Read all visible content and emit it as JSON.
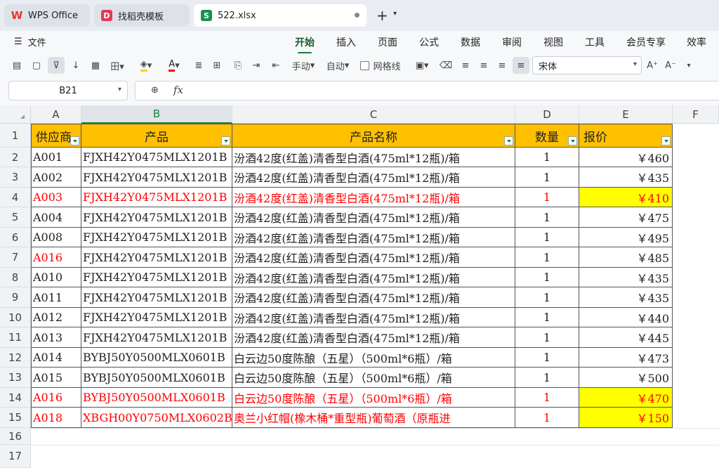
{
  "tabs": [
    {
      "label": "WPS Office",
      "icon": "wps-logo-icon",
      "color": "#e8342c"
    },
    {
      "label": "找稻壳模板",
      "icon": "docer-icon",
      "color": "#e23a53"
    },
    {
      "label": "522.xlsx",
      "icon": "sheet-icon",
      "color": "#1a8f4e"
    }
  ],
  "menu": {
    "file": "文件",
    "tabs": [
      "开始",
      "插入",
      "页面",
      "公式",
      "数据",
      "审阅",
      "视图",
      "工具",
      "会员专享",
      "效率"
    ],
    "active": "开始"
  },
  "toolbar": {
    "wrap_label": "手动",
    "autofit_label": "自动",
    "gridlines_label": "网格线",
    "font_name": "宋体"
  },
  "formula_bar": {
    "cell_ref": "B21",
    "fx": "fx",
    "value": ""
  },
  "columns": [
    "A",
    "B",
    "C",
    "D",
    "E",
    "F"
  ],
  "row_numbers": [
    "1",
    "2",
    "3",
    "4",
    "5",
    "6",
    "7",
    "8",
    "9",
    "10",
    "11",
    "12",
    "13",
    "14",
    "15",
    "16",
    "17"
  ],
  "headers": [
    "供应商",
    "产品",
    "产品名称",
    "数量",
    "报价"
  ],
  "rows": [
    {
      "supplier": "A001",
      "code": "FJXH42Y0475MLX1201B",
      "name": "汾酒42度(红盖)清香型白酒(475ml*12瓶)/箱",
      "qty": "1",
      "price": "￥460",
      "red": false,
      "yellow": false
    },
    {
      "supplier": "A002",
      "code": "FJXH42Y0475MLX1201B",
      "name": "汾酒42度(红盖)清香型白酒(475ml*12瓶)/箱",
      "qty": "1",
      "price": "￥435",
      "red": false,
      "yellow": false
    },
    {
      "supplier": "A003",
      "code": "FJXH42Y0475MLX1201B",
      "name": "汾酒42度(红盖)清香型白酒(475ml*12瓶)/箱",
      "qty": "1",
      "price": "￥410",
      "red": true,
      "yellow": true
    },
    {
      "supplier": "A004",
      "code": "FJXH42Y0475MLX1201B",
      "name": "汾酒42度(红盖)清香型白酒(475ml*12瓶)/箱",
      "qty": "1",
      "price": "￥475",
      "red": false,
      "yellow": false
    },
    {
      "supplier": "A008",
      "code": "FJXH42Y0475MLX1201B",
      "name": "汾酒42度(红盖)清香型白酒(475ml*12瓶)/箱",
      "qty": "1",
      "price": "￥495",
      "red": false,
      "yellow": false
    },
    {
      "supplier": "A016",
      "code": "FJXH42Y0475MLX1201B",
      "name": "汾酒42度(红盖)清香型白酒(475ml*12瓶)/箱",
      "qty": "1",
      "price": "￥485",
      "red": false,
      "yellow": false,
      "supplier_red": true
    },
    {
      "supplier": "A010",
      "code": "FJXH42Y0475MLX1201B",
      "name": "汾酒42度(红盖)清香型白酒(475ml*12瓶)/箱",
      "qty": "1",
      "price": "￥435",
      "red": false,
      "yellow": false
    },
    {
      "supplier": "A011",
      "code": "FJXH42Y0475MLX1201B",
      "name": "汾酒42度(红盖)清香型白酒(475ml*12瓶)/箱",
      "qty": "1",
      "price": "￥435",
      "red": false,
      "yellow": false
    },
    {
      "supplier": "A012",
      "code": "FJXH42Y0475MLX1201B",
      "name": "汾酒42度(红盖)清香型白酒(475ml*12瓶)/箱",
      "qty": "1",
      "price": "￥440",
      "red": false,
      "yellow": false
    },
    {
      "supplier": "A013",
      "code": "FJXH42Y0475MLX1201B",
      "name": "汾酒42度(红盖)清香型白酒(475ml*12瓶)/箱",
      "qty": "1",
      "price": "￥445",
      "red": false,
      "yellow": false
    },
    {
      "supplier": "A014",
      "code": "BYBJ50Y0500MLX0601B",
      "name": "白云边50度陈酿（五星）（500ml*6瓶）/箱",
      "qty": "1",
      "price": "￥473",
      "red": false,
      "yellow": false
    },
    {
      "supplier": "A015",
      "code": "BYBJ50Y0500MLX0601B",
      "name": "白云边50度陈酿（五星）（500ml*6瓶）/箱",
      "qty": "1",
      "price": "￥500",
      "red": false,
      "yellow": false
    },
    {
      "supplier": "A016",
      "code": "BYBJ50Y0500MLX0601B",
      "name": "白云边50度陈酿（五星）（500ml*6瓶）/箱",
      "qty": "1",
      "price": "￥470",
      "red": true,
      "yellow": true
    },
    {
      "supplier": "A018",
      "code": "XBGH00Y0750MLX0602B",
      "name": "奥兰小红帽(橡木桶*重型瓶)葡萄酒（原瓶进",
      "qty": "1",
      "price": "￥150",
      "red": true,
      "yellow": true
    }
  ]
}
